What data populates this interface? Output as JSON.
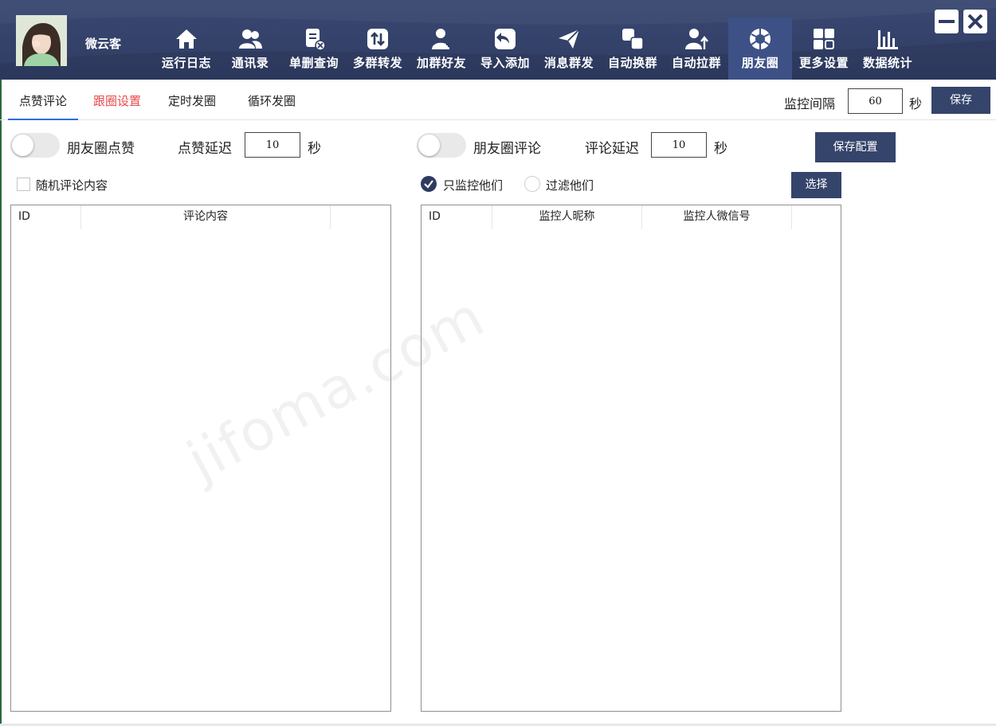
{
  "header": {
    "username": "微云客",
    "nav": [
      {
        "label": "运行日志",
        "icon": "home-icon"
      },
      {
        "label": "通讯录",
        "icon": "contacts-icon"
      },
      {
        "label": "单删查询",
        "icon": "delete-check-icon"
      },
      {
        "label": "多群转发",
        "icon": "forward-icon"
      },
      {
        "label": "加群好友",
        "icon": "add-friend-icon"
      },
      {
        "label": "导入添加",
        "icon": "import-icon"
      },
      {
        "label": "消息群发",
        "icon": "send-icon"
      },
      {
        "label": "自动换群",
        "icon": "switch-group-icon"
      },
      {
        "label": "自动拉群",
        "icon": "pull-group-icon"
      },
      {
        "label": "朋友圈",
        "icon": "moments-icon"
      },
      {
        "label": "更多设置",
        "icon": "grid-icon"
      },
      {
        "label": "数据统计",
        "icon": "bar-chart-icon"
      }
    ],
    "active_nav": "朋友圈",
    "colors": {
      "header_bg": "#2f3c63",
      "active_bg": "#3d5187"
    }
  },
  "tabs": [
    {
      "label": "点赞评论",
      "active": true
    },
    {
      "label": "跟圈设置",
      "highlight_color": "#e94b4b"
    },
    {
      "label": "定时发圈"
    },
    {
      "label": "循环发圈"
    }
  ],
  "monitor": {
    "label": "监控间隔",
    "value": "60",
    "unit": "秒",
    "save_label": "保存"
  },
  "like": {
    "toggle_label": "朋友圈点赞",
    "toggle_on": false,
    "delay_label": "点赞延迟",
    "delay_value": "10",
    "delay_unit": "秒"
  },
  "comment": {
    "toggle_label": "朋友圈评论",
    "toggle_on": false,
    "delay_label": "评论延迟",
    "delay_value": "10",
    "delay_unit": "秒"
  },
  "save_config_label": "保存配置",
  "random_comment": {
    "label": "随机评论内容",
    "checked": false
  },
  "filter": {
    "only_label": "只监控他们",
    "exclude_label": "过滤他们",
    "selected": "只监控他们",
    "select_button": "选择"
  },
  "left_table": {
    "columns": [
      "ID",
      "评论内容"
    ],
    "rows": []
  },
  "right_table": {
    "columns": [
      "ID",
      "监控人昵称",
      "监控人微信号"
    ],
    "rows": []
  },
  "watermark": "jifoma.com"
}
